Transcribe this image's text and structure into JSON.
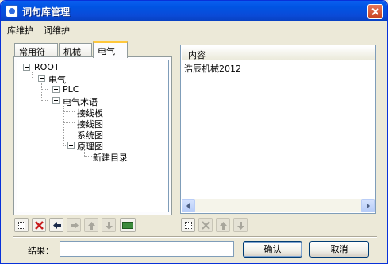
{
  "window": {
    "title": "词句库管理"
  },
  "menu": {
    "items": [
      "库维护",
      "词维护"
    ]
  },
  "tabs": [
    "常用符号",
    "机械",
    "电气"
  ],
  "tree": {
    "root": "ROOT",
    "n1": "电气",
    "n2": "PLC",
    "n3": "电气术语",
    "n4": "接线板",
    "n5": "接线图",
    "n6": "系统图",
    "n7": "原理图",
    "n8": "新建目录"
  },
  "list": {
    "header": "内容",
    "items": [
      "浩辰机械2012"
    ]
  },
  "footer": {
    "result_label": "结果：",
    "result_value": "",
    "ok_label": "确认",
    "cancel_label": "取消"
  },
  "colors": {
    "title_bar": "#0054E3",
    "active_tab_accent": "#FFC83C",
    "window_bg": "#ECE9D8"
  }
}
